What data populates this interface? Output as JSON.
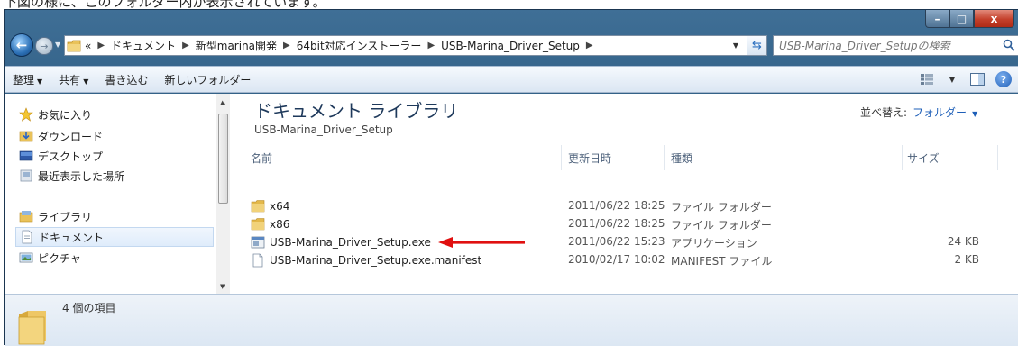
{
  "caption": "下図の様に、このフォルダー内が表示されています。",
  "window_controls": {
    "minimize": "–",
    "maximize": "□",
    "close": "x"
  },
  "address": {
    "crumbs": [
      "ドキュメント",
      "新型marina開発",
      "64bit対応インストーラー",
      "USB-Marina_Driver_Setup"
    ],
    "overflow": "«"
  },
  "search": {
    "placeholder": "USB-Marina_Driver_Setupの検索"
  },
  "toolbar": {
    "organize": "整理",
    "share": "共有",
    "burn": "書き込む",
    "new_folder": "新しいフォルダー"
  },
  "nav": {
    "favorites": "お気に入り",
    "downloads": "ダウンロード",
    "desktop": "デスクトップ",
    "recent": "最近表示した場所",
    "libraries": "ライブラリ",
    "documents": "ドキュメント",
    "pictures": "ピクチャ"
  },
  "library": {
    "title": "ドキュメント ライブラリ",
    "subtitle": "USB-Marina_Driver_Setup",
    "sort_label": "並べ替え:",
    "sort_value": "フォルダー"
  },
  "columns": {
    "name": "名前",
    "modified": "更新日時",
    "type": "種類",
    "size": "サイズ"
  },
  "files": [
    {
      "name": "x64",
      "modified": "2011/06/22 18:25",
      "type": "ファイル フォルダー",
      "size": "",
      "icon": "folder-icon"
    },
    {
      "name": "x86",
      "modified": "2011/06/22 18:25",
      "type": "ファイル フォルダー",
      "size": "",
      "icon": "folder-icon"
    },
    {
      "name": "USB-Marina_Driver_Setup.exe",
      "modified": "2011/06/22 15:23",
      "type": "アプリケーション",
      "size": "24 KB",
      "icon": "application-icon"
    },
    {
      "name": "USB-Marina_Driver_Setup.exe.manifest",
      "modified": "2010/02/17 10:02",
      "type": "MANIFEST ファイル",
      "size": "2 KB",
      "icon": "file-icon"
    }
  ],
  "status": {
    "count": "4 個の項目"
  },
  "colors": {
    "annotation_arrow": "#e01010",
    "title_blue": "#1e395b",
    "link_blue": "#1e5fb8"
  }
}
